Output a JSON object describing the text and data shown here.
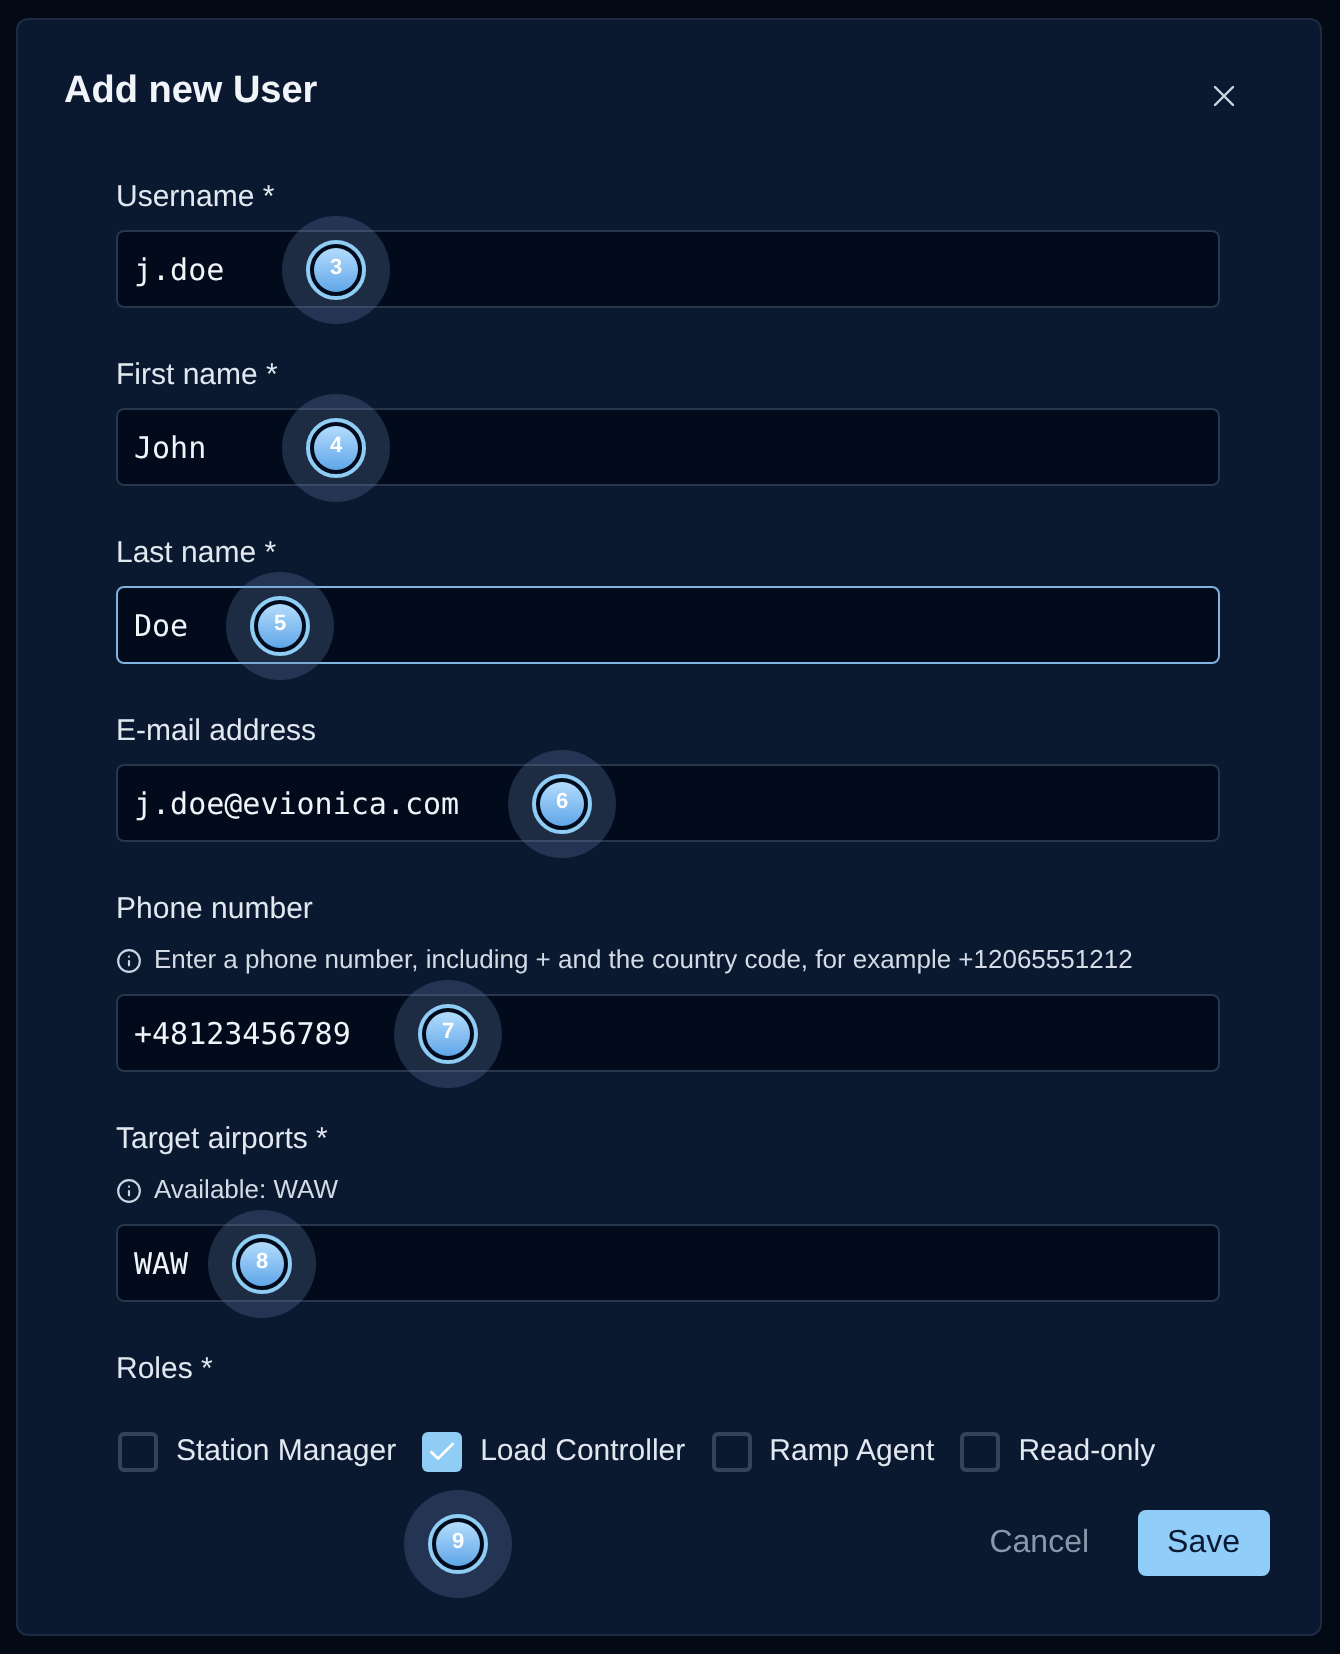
{
  "dialog": {
    "title": "Add new User"
  },
  "fields": [
    {
      "label": "Username *",
      "value": "j.doe",
      "focused": false,
      "marker": "3"
    },
    {
      "label": "First name *",
      "value": "John",
      "focused": false,
      "marker": "4"
    },
    {
      "label": "Last name *",
      "value": "Doe",
      "focused": true,
      "marker": "5"
    },
    {
      "label": "E-mail address",
      "value": "j.doe@evionica.com",
      "focused": false,
      "marker": "6"
    },
    {
      "label": "Phone number",
      "hint": "Enter a phone number, including + and the country code, for example +12065551212",
      "value": "+48123456789",
      "focused": false,
      "marker": "7"
    },
    {
      "label": "Target airports *",
      "hint": "Available: WAW",
      "value": "WAW",
      "focused": false,
      "marker": "8"
    }
  ],
  "roles": {
    "label": "Roles *",
    "options": [
      {
        "label": "Station Manager",
        "checked": false
      },
      {
        "label": "Load Controller",
        "checked": true
      },
      {
        "label": "Ramp Agent",
        "checked": false
      },
      {
        "label": "Read-only",
        "checked": false
      }
    ],
    "marker": "9"
  },
  "actions": [
    {
      "label": "Cancel",
      "kind": "secondary"
    },
    {
      "label": "Save",
      "kind": "primary"
    }
  ]
}
